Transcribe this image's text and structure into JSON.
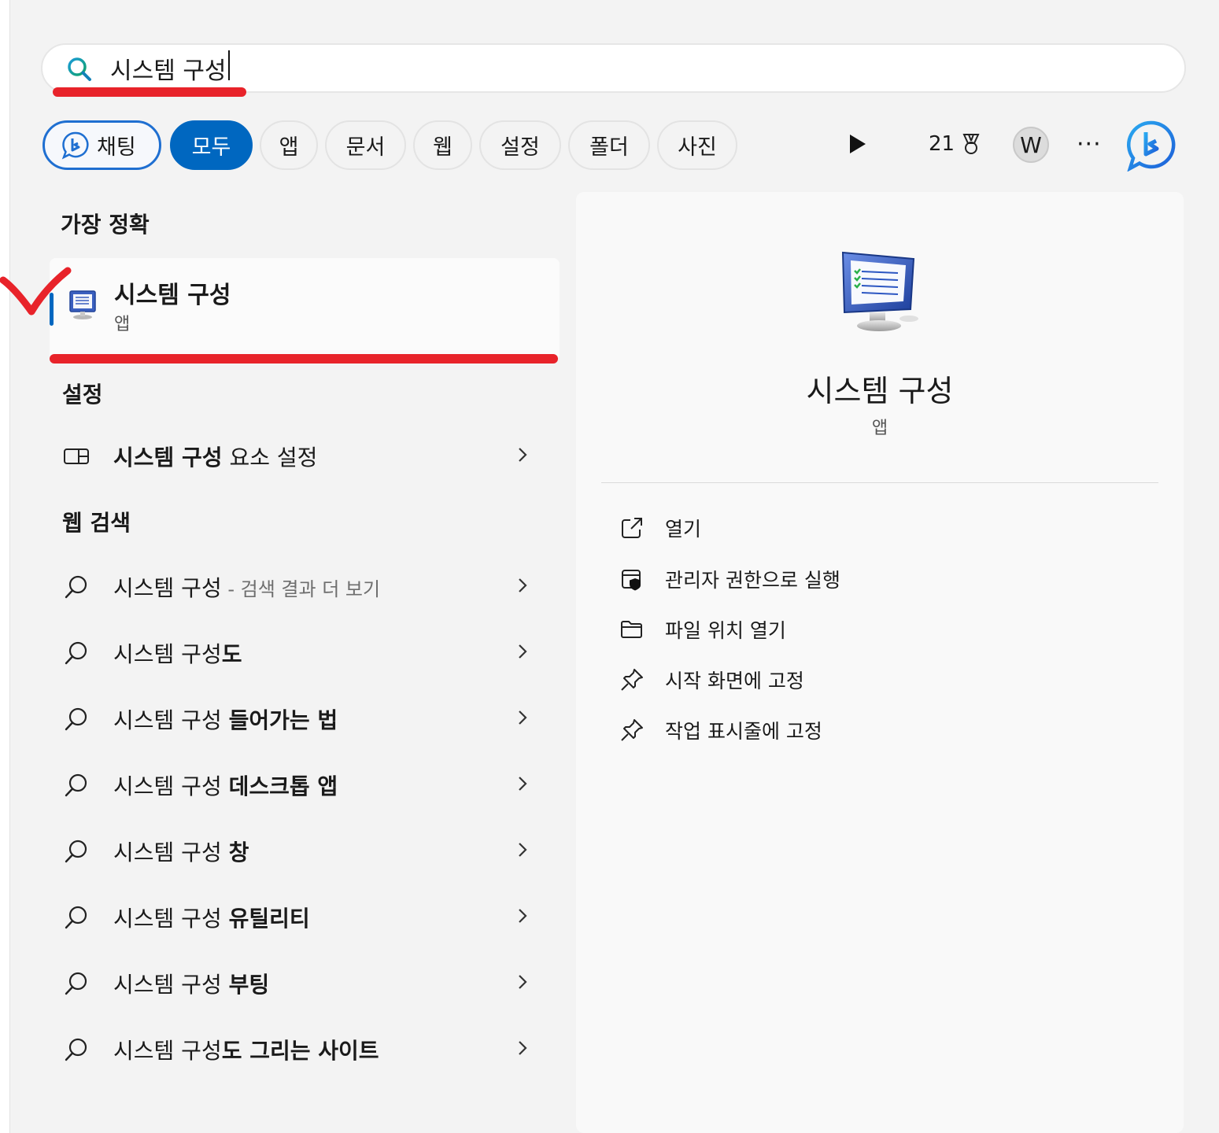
{
  "search": {
    "value": "시스템 구성",
    "icon": "search-icon"
  },
  "filters": {
    "chat": "채팅",
    "items": [
      "모두",
      "앱",
      "문서",
      "웹",
      "설정",
      "폴더",
      "사진"
    ],
    "active": "모두",
    "points": "21",
    "avatar": "W",
    "more": "···"
  },
  "best_match": {
    "heading": "가장 정확",
    "title": "시스템 구성",
    "subtitle": "앱"
  },
  "settings": {
    "heading": "설정",
    "item_bold": "시스템 구성",
    "item_rest": " 요소 설정"
  },
  "web": {
    "heading": "웹 검색",
    "items": [
      {
        "prefix": "시스템 구성",
        "bold": "",
        "dim": " - 검색 결과 더 보기"
      },
      {
        "prefix": "시스템 구성",
        "bold": "도",
        "dim": ""
      },
      {
        "prefix": "시스템 구성 ",
        "bold": "들어가는 법",
        "dim": ""
      },
      {
        "prefix": "시스템 구성 ",
        "bold": "데스크톱 앱",
        "dim": ""
      },
      {
        "prefix": "시스템 구성 ",
        "bold": "창",
        "dim": ""
      },
      {
        "prefix": "시스템 구성 ",
        "bold": "유틸리티",
        "dim": ""
      },
      {
        "prefix": "시스템 구성 ",
        "bold": "부팅",
        "dim": ""
      },
      {
        "prefix": "시스템 구성",
        "bold": "도 그리는 사이트",
        "dim": ""
      }
    ]
  },
  "detail": {
    "title": "시스템 구성",
    "subtitle": "앱",
    "actions": [
      {
        "label": "열기",
        "icon": "open-external-icon"
      },
      {
        "label": "관리자 권한으로 실행",
        "icon": "admin-shield-icon"
      },
      {
        "label": "파일 위치 열기",
        "icon": "folder-icon"
      },
      {
        "label": "시작 화면에 고정",
        "icon": "pin-icon"
      },
      {
        "label": "작업 표시줄에 고정",
        "icon": "pin-icon"
      }
    ]
  },
  "colors": {
    "accent": "#0067c0",
    "annotation_red": "#e8232a"
  }
}
